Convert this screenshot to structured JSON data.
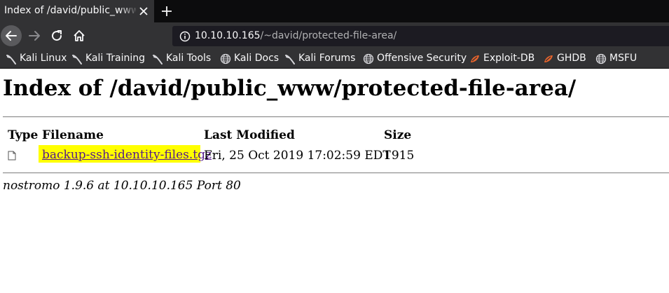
{
  "browser": {
    "tab": {
      "title": "Index of /david/public_www/protected-file-area/"
    },
    "url": {
      "host": "10.10.10.165",
      "path": "/~david/protected-file-area/"
    },
    "bookmarks": [
      {
        "label": "Kali Linux",
        "icon": "kali-dragon-icon"
      },
      {
        "label": "Kali Training",
        "icon": "kali-dragon-icon"
      },
      {
        "label": "Kali Tools",
        "icon": "kali-dragon-icon"
      },
      {
        "label": "Kali Docs",
        "icon": "globe-icon"
      },
      {
        "label": "Kali Forums",
        "icon": "kali-dragon-icon"
      },
      {
        "label": "Offensive Security",
        "icon": "globe-icon"
      },
      {
        "label": "Exploit-DB",
        "icon": "exploit-db-icon"
      },
      {
        "label": "GHDB",
        "icon": "exploit-db-icon"
      },
      {
        "label": "MSFU",
        "icon": "globe-icon"
      }
    ],
    "colors": {
      "tabbar": "#0c0c0d",
      "toolbar": "#323234",
      "urlbar": "#1c1b22",
      "exploit_icon": "#e8642c"
    }
  },
  "page": {
    "heading": "Index of /david/public_www/protected-file-area/",
    "table": {
      "headers": {
        "type": "Type",
        "filename": "Filename",
        "modified": "Last Modified",
        "size": "Size"
      },
      "rows": [
        {
          "filename": "backup-ssh-identity-files.tgz",
          "modified": "Fri, 25 Oct 2019 17:02:59 EDT",
          "size": "1915"
        }
      ]
    },
    "footer": "nostromo 1.9.6 at 10.10.10.165 Port 80",
    "colors": {
      "highlight": "#ffff00",
      "link": "#551a8b"
    }
  }
}
